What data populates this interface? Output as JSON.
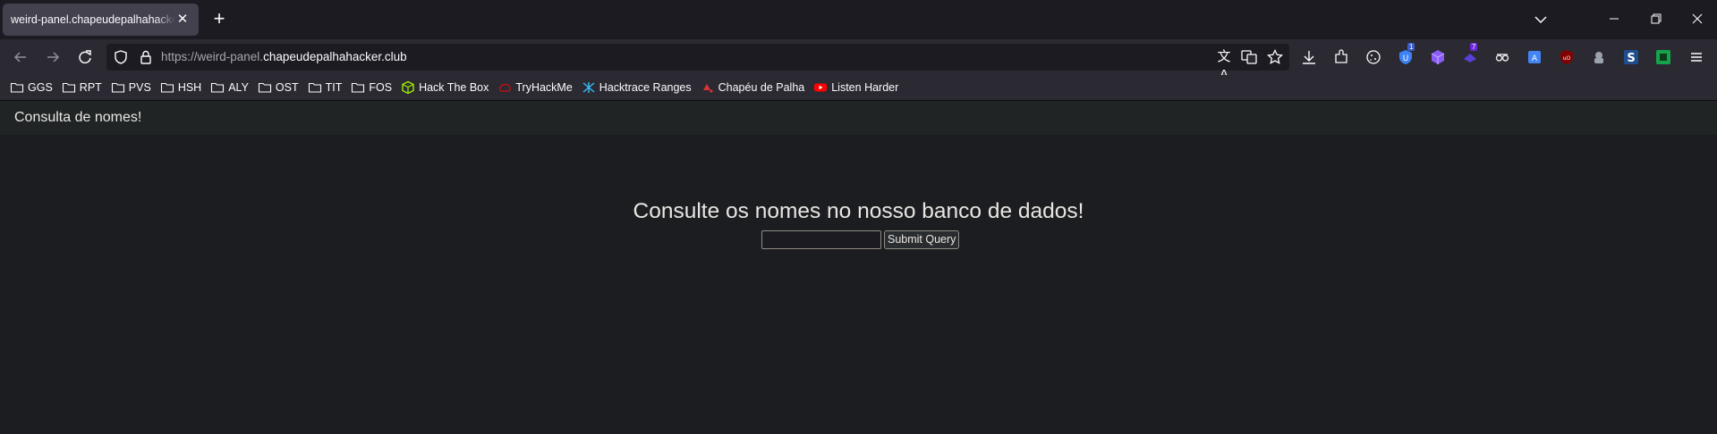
{
  "browser": {
    "tab": {
      "title": "weird-panel.chapeudepalhahacker.club"
    },
    "url": {
      "prefix": "https://weird-panel.",
      "domain": "chapeudepalhahacker.club"
    },
    "bookmarks": [
      {
        "label": "GGS",
        "icon": "folder-icon"
      },
      {
        "label": "RPT",
        "icon": "folder-icon"
      },
      {
        "label": "PVS",
        "icon": "folder-icon"
      },
      {
        "label": "HSH",
        "icon": "folder-icon"
      },
      {
        "label": "ALY",
        "icon": "folder-icon"
      },
      {
        "label": "OST",
        "icon": "folder-icon"
      },
      {
        "label": "TIT",
        "icon": "folder-icon"
      },
      {
        "label": "FOS",
        "icon": "folder-icon"
      },
      {
        "label": "Hack The Box",
        "icon": "hackthebox-icon"
      },
      {
        "label": "TryHackMe",
        "icon": "tryhackme-icon"
      },
      {
        "label": "Hacktrace Ranges",
        "icon": "hacktrace-icon"
      },
      {
        "label": "Chapéu de Palha",
        "icon": "chapeu-icon"
      },
      {
        "label": "Listen Harder",
        "icon": "youtube-icon"
      }
    ],
    "extension_badges": {
      "ublock_count": "1",
      "purple_count": "7"
    }
  },
  "page": {
    "brand": "Consulta de nomes!",
    "headline": "Consulte os nomes no nosso banco de dados!",
    "search": {
      "value": "",
      "submit_label": "Submit Query"
    }
  },
  "colors": {
    "chrome_bg": "#1c1b22",
    "toolbar_bg": "#2b2a33",
    "page_bg": "#1c1d20",
    "header_bg": "#212425",
    "text": "#e8e6e3"
  }
}
